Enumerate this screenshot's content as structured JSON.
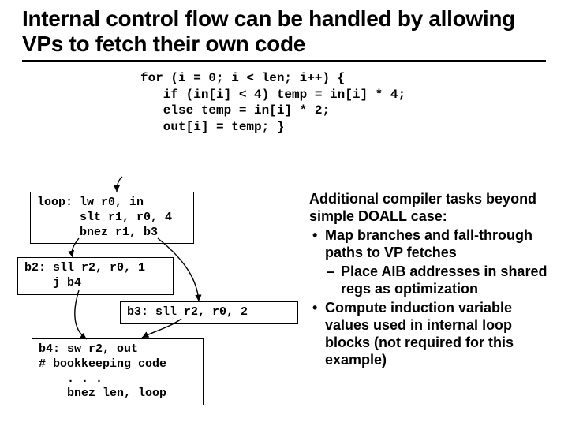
{
  "title": "Internal control flow can be handled by allowing VPs to fetch their own code",
  "code_c": "for (i = 0; i < len; i++) {\n   if (in[i] < 4) temp = in[i] * 4;\n   else temp = in[i] * 2;\n   out[i] = temp; }",
  "asm": {
    "loop": "loop: lw r0, in\n      slt r1, r0, 4\n      bnez r1, b3",
    "b2": "b2: sll r2, r0, 1\n    j b4",
    "b3": "b3: sll r2, r0, 2",
    "b4": "b4: sw r2, out\n# bookkeeping code\n    . . .\n    bnez len, loop"
  },
  "right_heading": "Additional compiler tasks beyond simple DOALL case:",
  "bullets": {
    "b1": "Map branches and fall-through paths to VP fetches",
    "b1a": "Place AIB addresses in shared regs as optimization",
    "b2": "Compute induction variable values used in internal loop blocks (not required for this example)"
  }
}
